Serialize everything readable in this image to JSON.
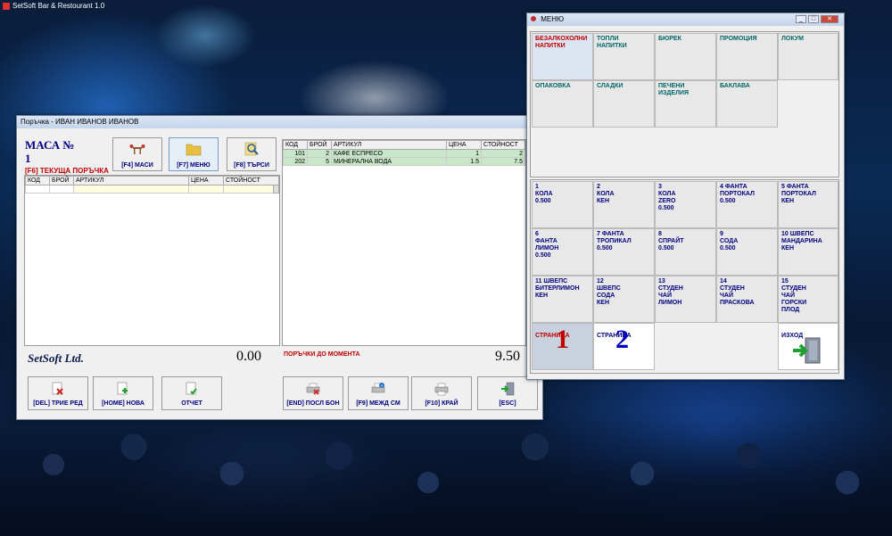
{
  "app": {
    "title": "SetSoft Bar & Restourant 1.0"
  },
  "order_window": {
    "title": "Поръчка - ИВАН ИВАНОВ ИВАНОВ",
    "table_label": "МАСА №",
    "table_number": "1",
    "current_order_key": "[F6]",
    "current_order_label": "ТЕКУЩА ПОРЪЧКА",
    "top_buttons": [
      {
        "label": "[F4] МАСИ",
        "icon": "tables-icon"
      },
      {
        "label": "[F7] МЕНЮ",
        "icon": "folder-icon"
      },
      {
        "label": "[F8] ТЪРСИ",
        "icon": "search-icon"
      }
    ],
    "current_grid": {
      "columns": [
        "КОД",
        "БРОЙ",
        "АРТИКУЛ",
        "ЦЕНА",
        "СТОЙНОСТ"
      ],
      "rows": []
    },
    "history_grid": {
      "columns": [
        "КОД",
        "БРОЙ",
        "АРТИКУЛ",
        "ЦЕНА",
        "СТОЙНОСТ"
      ],
      "rows": [
        {
          "code": "101",
          "qty": "2",
          "item": "КАФЕ ЕСПРЕСО",
          "price": "1",
          "total": "2"
        },
        {
          "code": "202",
          "qty": "5",
          "item": "МИНЕРАЛНА ВОДА",
          "price": "1.5",
          "total": "7.5"
        }
      ]
    },
    "logo": "SetSoft Ltd.",
    "current_total": "0.00",
    "orders_so_far_label": "ПОРЪЧКИ ДО МОМЕНТА",
    "orders_so_far_total": "9.50",
    "bottom_buttons": [
      {
        "label": "[DEL] ТРИЕ РЕД",
        "icon": "delete-row-icon"
      },
      {
        "label": "[HOME] НОВА",
        "icon": "new-icon"
      },
      {
        "label": "ОТЧЕТ",
        "icon": "report-icon"
      },
      {
        "label": "[END] ПОСЛ БОН",
        "icon": "last-receipt-icon"
      },
      {
        "label": "[F9] МЕЖД СМ",
        "icon": "interim-bill-icon"
      },
      {
        "label": "[F10] КРАЙ",
        "icon": "print-icon"
      },
      {
        "label": "[ESC]",
        "icon": "exit-icon"
      }
    ]
  },
  "menu_window": {
    "title": "МЕНЮ",
    "categories": [
      "БЕЗАЛКОХОЛНИ\nНАПИТКИ",
      "ТОПЛИ\nНАПИТКИ",
      "БЮРЕК",
      "ПРОМОЦИЯ",
      "ЛОКУМ",
      "ОПАКОВКА",
      "СЛАДКИ",
      "ПЕЧЕНИ\nИЗДЕЛИЯ",
      "БАКЛАВА"
    ],
    "items": [
      "1\nКОЛА\n0.500",
      "2\nКОЛА\nКЕН",
      "3\nКОЛА\nZERO\n0.500",
      "4 ФАНТА\nПОРТОКАЛ\n0.500",
      "5 ФАНТА\nПОРТОКАЛ\nКЕН",
      "6\nФАНТА\nЛИМОН\n0.500",
      "7 ФАНТА\nТРОПИКАЛ\n0.500",
      "8\nСПРАЙТ\n0.500",
      "9\nСОДА\n0.500",
      "10 ШВЕПС\nМАНДАРИНА\nКЕН",
      "11 ШВЕПС\nБИТЕРЛИМОН\nКЕН",
      "12\nШВЕПС\nСОДА\nКЕН",
      "13\nСТУДЕН\nЧАЙ\nЛИМОН",
      "14\nСТУДЕН\nЧАЙ\nПРАСКОВА",
      "15\nСТУДЕН\nЧАЙ\nГОРСКИ\nПЛОД"
    ],
    "page_label": "СТРАНИЦА",
    "pages": [
      "1",
      "2"
    ],
    "exit_label": "ИЗХОД",
    "colors": {
      "selected": "#c00000",
      "page1": "#c00000",
      "page2": "#0000c0"
    }
  }
}
